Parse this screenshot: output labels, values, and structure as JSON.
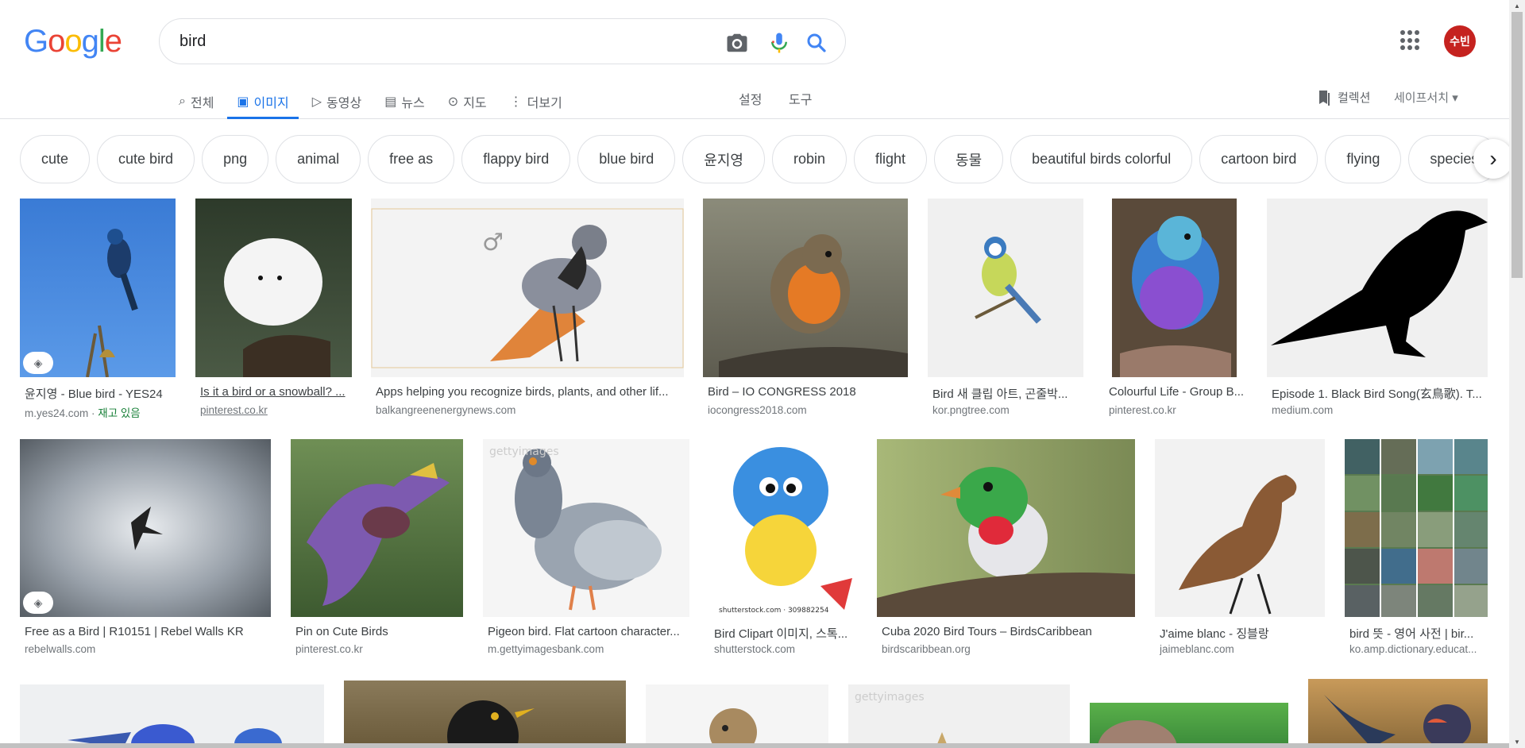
{
  "search": {
    "query": "bird",
    "camera_icon": "camera-icon",
    "mic_icon": "mic-icon",
    "search_icon": "search-icon"
  },
  "account": {
    "avatar_text": "수빈",
    "avatar_color": "#c5221f"
  },
  "tabs": [
    {
      "label": "전체",
      "icon": "search-icon",
      "glyph": "⌕"
    },
    {
      "label": "이미지",
      "icon": "image-icon",
      "glyph": "▣",
      "active": true
    },
    {
      "label": "동영상",
      "icon": "video-icon",
      "glyph": "▷"
    },
    {
      "label": "뉴스",
      "icon": "news-icon",
      "glyph": "▤"
    },
    {
      "label": "지도",
      "icon": "map-pin-icon",
      "glyph": "⊙"
    },
    {
      "label": "더보기",
      "icon": "more-vert-icon",
      "glyph": "⋮"
    }
  ],
  "tools": {
    "settings": "설정",
    "tools": "도구"
  },
  "right_tools": {
    "collection": "컬렉션",
    "safesearch": "세이프서치"
  },
  "chips": [
    "cute",
    "cute bird",
    "png",
    "animal",
    "free as",
    "flappy bird",
    "blue bird",
    "윤지영",
    "robin",
    "flight",
    "동물",
    "beautiful birds colorful",
    "cartoon bird",
    "flying",
    "species"
  ],
  "row1": [
    {
      "title": "윤지영 - Blue bird - YES24",
      "source": "m.yes24.com",
      "stock": "재고 있음",
      "badge": true
    },
    {
      "title": "Is it a bird or a snowball? ...",
      "source": "pinterest.co.kr"
    },
    {
      "title": "Apps helping you recognize birds, plants, and other lif...",
      "source": "balkangreenenergynews.com"
    },
    {
      "title": "Bird – IO CONGRESS 2018",
      "source": "iocongress2018.com"
    },
    {
      "title": "Bird 새 클립 아트, 곤줄박...",
      "source": "kor.pngtree.com"
    },
    {
      "title": "Colourful Life - Group B...",
      "source": "pinterest.co.kr"
    },
    {
      "title": "Episode 1. Black Bird Song(玄鳥歌). T...",
      "source": "medium.com"
    }
  ],
  "row2": [
    {
      "title": "Free as a Bird | R10151 | Rebel Walls KR",
      "source": "rebelwalls.com",
      "badge": true
    },
    {
      "title": "Pin on Cute Birds",
      "source": "pinterest.co.kr"
    },
    {
      "title": "Pigeon bird. Flat cartoon character...",
      "source": "m.gettyimagesbank.com"
    },
    {
      "title": "Bird Clipart 이미지, 스톡...",
      "source": "shutterstock.com"
    },
    {
      "title": "Cuba 2020 Bird Tours – BirdsCaribbean",
      "source": "birdscaribbean.org"
    },
    {
      "title": "J'aime blanc - 징블랑",
      "source": "jaimeblanc.com"
    },
    {
      "title": "bird 뜻 - 영어 사전 | bir...",
      "source": "ko.amp.dictionary.educat..."
    }
  ]
}
